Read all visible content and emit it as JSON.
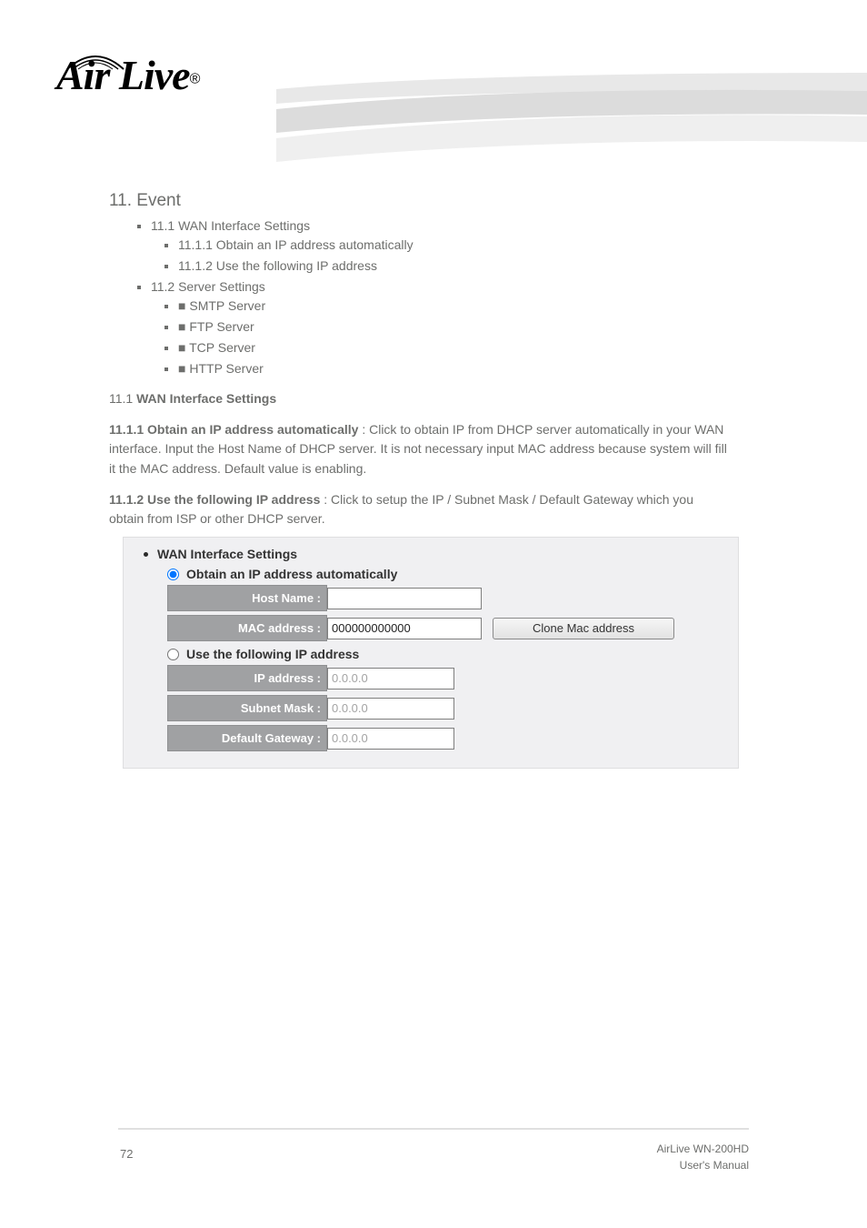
{
  "header": {
    "brand_name": "Air Live"
  },
  "section": {
    "chapter": "11. Event",
    "toc1": "11.1 WAN Interface Settings",
    "toc1a": "11.1.1 Obtain an IP address automatically",
    "toc1c": "11.1.2 Use the following IP address",
    "toc2": "11.2 Server Settings",
    "toc2a": "SMTP Server",
    "toc2b": "FTP Server",
    "toc2c": "TCP Server",
    "toc2d": "HTTP Server"
  },
  "body": {
    "para1_prefix": "11.1 ",
    "para1_bold": "WAN Interface Settings",
    "para2_bold": "11.1.1 Obtain an IP address automatically ",
    "para2_rest": ": Click to obtain IP from DHCP server automatically in your WAN interface. Input the Host Name of DHCP server. It is not necessary input MAC address because system will fill it the MAC address. Default value is enabling.",
    "para3_bold": "11.1.2 Use the following IP address ",
    "para3_rest": ": Click to setup the IP / Subnet Mask / Default Gateway which you obtain from ISP or other DHCP server."
  },
  "panel": {
    "title": "WAN Interface Settings",
    "radio_auto": "Obtain an IP address automatically",
    "radio_static": "Use the following IP address",
    "host_name_label": "Host Name :",
    "mac_label": "MAC address :",
    "mac_value": "000000000000",
    "clone_btn": "Clone Mac address",
    "ip_label": "IP address :",
    "subnet_label": "Subnet Mask :",
    "gateway_label": "Default Gateway :",
    "zero_ip": "0.0.0.0"
  },
  "footer": {
    "page_no": "72",
    "brand_line1": "AirLive WN-200HD",
    "brand_line2": "User's Manual"
  }
}
